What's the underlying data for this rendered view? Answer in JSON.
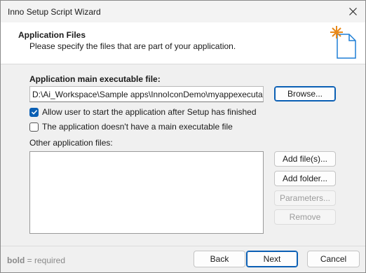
{
  "window": {
    "title": "Inno Setup Script Wizard"
  },
  "header": {
    "title": "Application Files",
    "subtitle": "Please specify the files that are part of your application."
  },
  "main_exe": {
    "label": "Application main executable file:",
    "value": "D:\\Ai_Workspace\\Sample apps\\InnoIconDemo\\myappexecutable",
    "browse_label": "Browse..."
  },
  "options": {
    "allow_start_label": "Allow user to start the application after Setup has finished",
    "allow_start_checked": true,
    "no_main_exe_label": "The application doesn't have a main executable file",
    "no_main_exe_checked": false
  },
  "other_files": {
    "label": "Other application files:",
    "add_files_label": "Add file(s)...",
    "add_folder_label": "Add folder...",
    "parameters_label": "Parameters...",
    "remove_label": "Remove"
  },
  "footer": {
    "bold_word": "bold",
    "note_rest": " = required",
    "back_label": "Back",
    "next_label": "Next",
    "cancel_label": "Cancel"
  },
  "colors": {
    "accent": "#0a5fb4",
    "icon_star": "#e8891a",
    "icon_doc": "#1e7fd6"
  }
}
